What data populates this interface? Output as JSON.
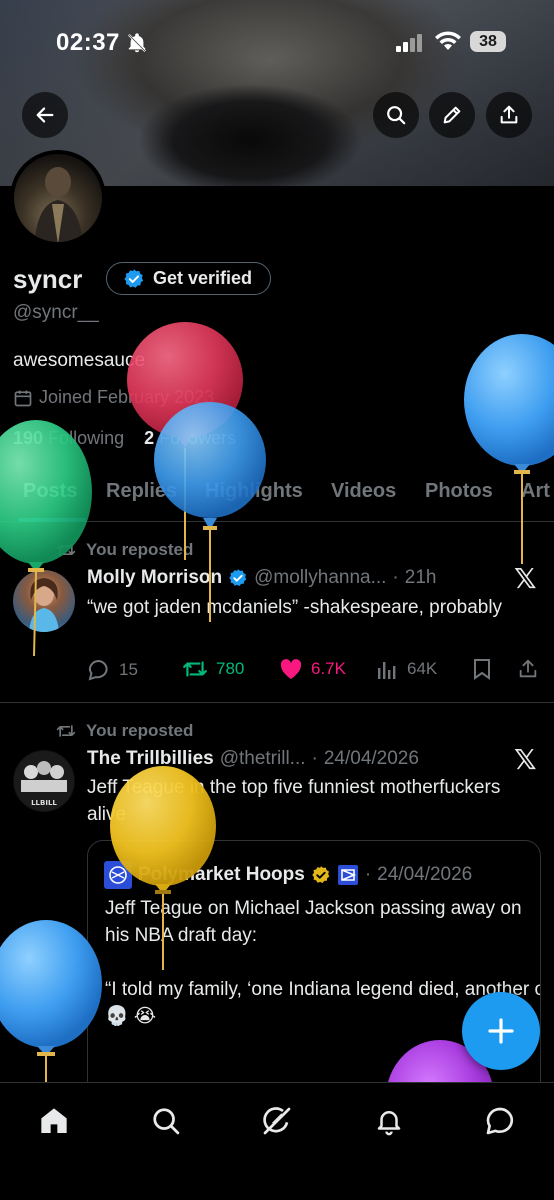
{
  "status_bar": {
    "time": "02:37",
    "battery": "38"
  },
  "profile": {
    "name": "syncr",
    "get_verified_label": "Get verified",
    "handle": "@syncr__",
    "bio": "awesomesauce",
    "joined": "Joined February 2023",
    "following_count": "190",
    "following_label": "Following",
    "followers_count": "2",
    "followers_label": "Followers"
  },
  "tabs": [
    {
      "label": "Posts",
      "active": true
    },
    {
      "label": "Replies"
    },
    {
      "label": "Highlights"
    },
    {
      "label": "Videos"
    },
    {
      "label": "Photos"
    },
    {
      "label": "Art"
    }
  ],
  "posts": [
    {
      "repost_label": "You reposted",
      "author": "Molly Morrison",
      "handle": "@mollyhanna...",
      "dot": "·",
      "time": "21h",
      "text": "“we got jaden mcdaniels” -shakespeare, probably",
      "replies": "15",
      "reposts": "780",
      "likes": "6.7K",
      "views": "64K"
    },
    {
      "repost_label": "You reposted",
      "author": "The Trillbillies",
      "handle": "@thetrill...",
      "dot": "·",
      "time": "24/04/2026",
      "avatar_text": "LLBILL",
      "text": "Jeff Teague in the top five funniest motherfuckers alive",
      "quote": {
        "author": "Polymarket Hoops",
        "dot": "·",
        "time": "24/04/2026",
        "line1": "Jeff Teague on Michael Jackson passing away on his NBA draft day:",
        "line2": "“I told my family, ‘one Indiana legend died, another one was born,’ and they got m",
        "emoji": "💀 😭"
      }
    }
  ],
  "x_logo": "𝕏",
  "colors": {
    "accent": "#1d9bf0",
    "repost_green": "#00ba7c",
    "like_pink": "#f91880",
    "muted": "#71767b",
    "divider": "#2f3336"
  }
}
